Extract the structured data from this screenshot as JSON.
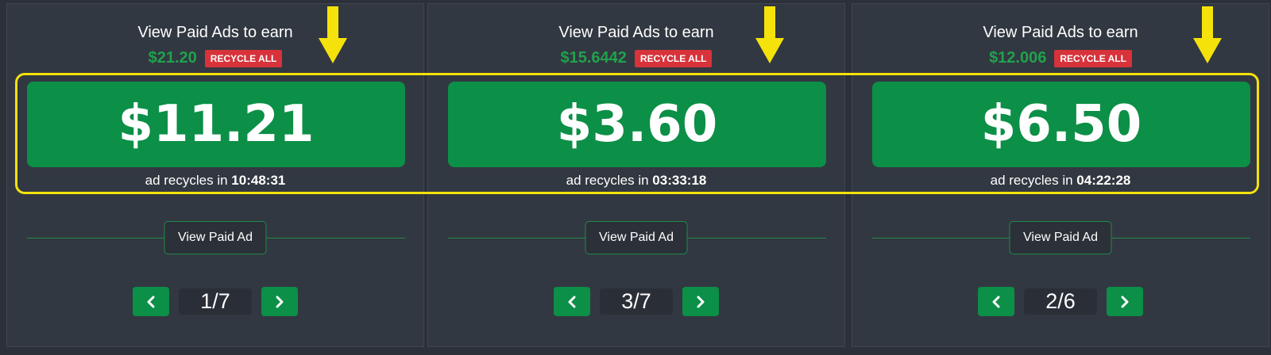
{
  "panels": [
    {
      "title": "View Paid Ads to earn",
      "earn_amount": "$21.20",
      "recycle_label": "RECYCLE ALL",
      "price": "$11.21",
      "recycle_prefix": "ad recycles in",
      "recycle_time": "10:48:31",
      "view_ad_label": "View Paid Ad",
      "page": "1/7"
    },
    {
      "title": "View Paid Ads to earn",
      "earn_amount": "$15.6442",
      "recycle_label": "RECYCLE ALL",
      "price": "$3.60",
      "recycle_prefix": "ad recycles in",
      "recycle_time": "03:33:18",
      "view_ad_label": "View Paid Ad",
      "page": "3/7"
    },
    {
      "title": "View Paid Ads to earn",
      "earn_amount": "$12.006",
      "recycle_label": "RECYCLE ALL",
      "price": "$6.50",
      "recycle_prefix": "ad recycles in",
      "recycle_time": "04:22:28",
      "view_ad_label": "View Paid Ad",
      "page": "2/6"
    }
  ],
  "icons": {
    "prev": "chevron-left-icon",
    "next": "chevron-right-icon",
    "annotation": "arrow-down-icon"
  },
  "colors": {
    "background": "#2c3038",
    "panel": "#323841",
    "accent_green": "#0c8f47",
    "earn_green": "#1fa24c",
    "recycle_red": "#d8323a",
    "highlight_yellow": "#f5e20b"
  }
}
